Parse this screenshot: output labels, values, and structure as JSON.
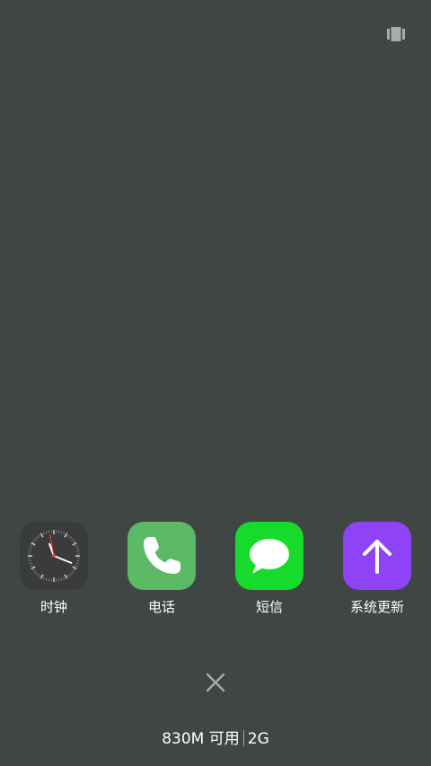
{
  "top_bar": {
    "icon": "task-list-icon"
  },
  "dock": {
    "apps": [
      {
        "label": "时钟",
        "icon": "clock-icon",
        "icon_bg": "#3a3b3d"
      },
      {
        "label": "电话",
        "icon": "phone-icon",
        "icon_bg": "#5cba67"
      },
      {
        "label": "短信",
        "icon": "message-icon",
        "icon_bg": "#16db2c"
      },
      {
        "label": "系统更新",
        "icon": "arrow-up-icon",
        "icon_bg": "#8e44f6"
      }
    ]
  },
  "close": {
    "icon": "close-icon"
  },
  "memory": {
    "available": "830M 可用",
    "total": "2G"
  },
  "colors": {
    "background": "#3f4643",
    "text": "#ffffff"
  }
}
